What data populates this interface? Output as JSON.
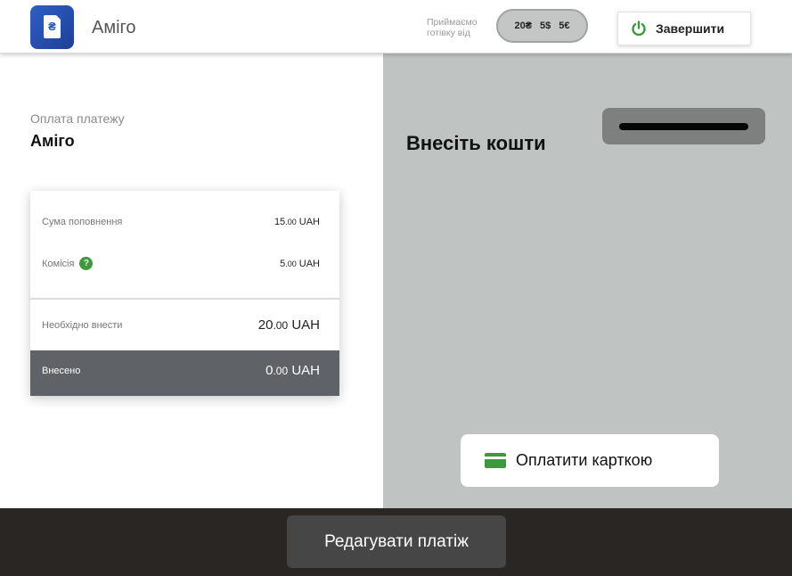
{
  "header": {
    "app_title": "Аміго",
    "logo_symbol": "₴",
    "accept_label": "Приймаємо готівку від",
    "cash_denominations": [
      "20₴",
      "5$",
      "5€"
    ],
    "finish_label": "Завершити"
  },
  "payment": {
    "caption": "Оплата платежу",
    "name": "Аміго"
  },
  "summary": {
    "rows": [
      {
        "label": "Сума поповнення",
        "value_int": "15",
        "value_dec": ".00",
        "currency": "UAH"
      },
      {
        "label": "Комісія",
        "value_int": "5",
        "value_dec": ".00",
        "currency": "UAH",
        "help": "?"
      }
    ],
    "required": {
      "label": "Необхідно внести",
      "value_int": "20",
      "value_dec": ".00",
      "currency": "UAH"
    },
    "paid": {
      "label": "Внесено",
      "value_int": "0",
      "value_dec": ".00",
      "currency": "UAH"
    }
  },
  "right_panel": {
    "insert_title": "Внесіть кошти",
    "card_pay_label": "Оплатити карткою"
  },
  "footer": {
    "edit_label": "Редагувати платіж"
  },
  "colors": {
    "accent_green": "#3d9a3a",
    "right_panel_bg": "#bfc3c1",
    "footer_bg": "#2a2624",
    "paid_strip_bg": "#5f6368",
    "logo_blue": "#2a55b7"
  },
  "icons": [
    "document-hryvnia-logo-icon",
    "power-icon",
    "help-icon",
    "credit-card-icon"
  ]
}
